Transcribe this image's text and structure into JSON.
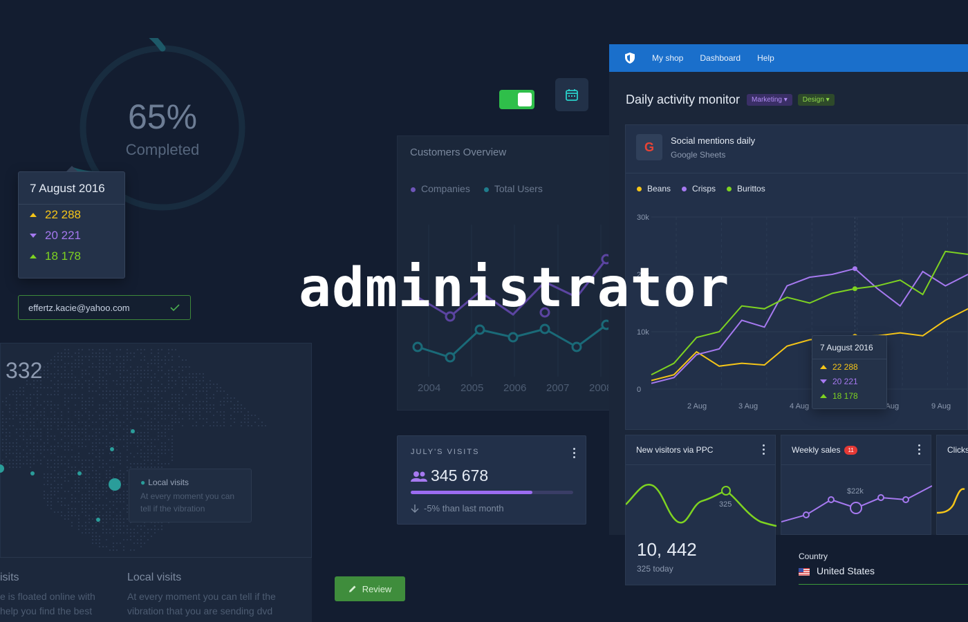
{
  "progress": {
    "value": 0.65,
    "percent_label": "65%",
    "label": "Completed"
  },
  "tooltip_left": {
    "date": "7 August 2016",
    "rows": [
      {
        "value": "22 288",
        "trend": "up",
        "color": "#f5c518"
      },
      {
        "value": "20 221",
        "trend": "down",
        "color": "#a679f0"
      },
      {
        "value": "18 178",
        "trend": "up",
        "color": "#7ed321"
      }
    ]
  },
  "email_field": {
    "value": "effertz.kacie@yahoo.com",
    "icon": "check-icon"
  },
  "map": {
    "number": "332",
    "tooltip": {
      "title": "Local visits",
      "text": "At every moment you can tell if the vibration",
      "icon": "pin-icon"
    },
    "bottom": [
      {
        "title": "isits",
        "text": "e is floated online with help you find the best"
      },
      {
        "title": "Local visits",
        "text": "At every moment you can tell if the vibration that you are sending dvd"
      }
    ]
  },
  "toggle": {
    "state": "on",
    "color": "#2fbf4a"
  },
  "calendar_button": {
    "icon": "calendar-icon"
  },
  "customers_overview": {
    "title": "Customers Overview",
    "legend": [
      {
        "label": "Companies",
        "color": "#6e55b8"
      },
      {
        "label": "Total Users",
        "color": "#1f7c8c"
      }
    ],
    "years": [
      "2004",
      "2005",
      "2006",
      "2007",
      "2008"
    ]
  },
  "overlay_word": "administrator",
  "july_visits": {
    "label": "JULY'S VISITS",
    "value": "345 678",
    "progress": 0.75,
    "sub": "-5% than last month",
    "icon": "users-icon"
  },
  "review_button": {
    "label": "Review",
    "icon": "pencil-icon"
  },
  "navbar": {
    "logo": "shield-icon",
    "items": [
      "My shop",
      "Dashboard",
      "Help"
    ],
    "color": "#1a6fcb"
  },
  "dashboard": {
    "title": "Daily activity monitor",
    "tags": [
      {
        "label": "Marketing",
        "color": "#a679f0"
      },
      {
        "label": "Design",
        "color": "#7ed321"
      }
    ],
    "card": {
      "title": "Social mentions daily",
      "subtitle": "Google Sheets",
      "icon": "google-icon",
      "icon_letter": "G"
    }
  },
  "tooltip_chart": {
    "date": "7 August 2016",
    "rows": [
      {
        "value": "22 288",
        "trend": "up",
        "color": "#f5c518"
      },
      {
        "value": "20 221",
        "trend": "down",
        "color": "#a679f0"
      },
      {
        "value": "18 178",
        "trend": "up",
        "color": "#7ed321"
      }
    ]
  },
  "chart_data": {
    "type": "line",
    "title": "",
    "series": [
      {
        "name": "Beans",
        "color": "#f5c518",
        "values": [
          1500,
          2500,
          6500,
          4000,
          4500,
          4200,
          7500,
          8600,
          9000,
          9200,
          9300,
          9800,
          9300,
          12000,
          14000
        ]
      },
      {
        "name": "Crisps",
        "color": "#a679f0",
        "values": [
          1000,
          2000,
          6000,
          7000,
          12000,
          10800,
          18000,
          19500,
          20000,
          21000,
          17500,
          14500,
          20500,
          18000,
          20000
        ]
      },
      {
        "name": "Burittos",
        "color": "#7ed321",
        "values": [
          2500,
          4500,
          9000,
          10000,
          14500,
          14000,
          16000,
          15000,
          16700,
          17500,
          18000,
          19000,
          16500,
          24000,
          23500
        ]
      }
    ],
    "x_ticks": [
      "2 Aug",
      "3 Aug",
      "4 Aug",
      "8 Aug",
      "9 Aug"
    ],
    "y_ticks": [
      "30k",
      "20k",
      "10k",
      "0"
    ],
    "ylim": [
      0,
      30000
    ],
    "grid": true,
    "legend_position": "top-left"
  },
  "ppc_card": {
    "title": "New visitors via PPC",
    "value": "10, 442",
    "sub": "325 today",
    "point_label": "325"
  },
  "weekly_card": {
    "title": "Weekly sales",
    "badge": "11",
    "point_label": "$22k"
  },
  "clicks_card": {
    "title": "Clicks"
  },
  "country": {
    "label": "Country",
    "value": "United States",
    "flag": "us-flag-icon"
  }
}
